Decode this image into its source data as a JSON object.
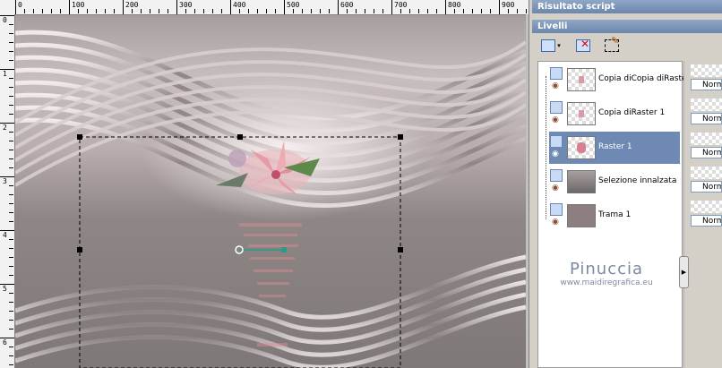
{
  "ruler": {
    "top_labels": [
      "0",
      "100",
      "200",
      "300",
      "400",
      "500",
      "600",
      "700",
      "800",
      "900"
    ],
    "left_labels": [
      "0",
      "1",
      "2",
      "3",
      "4",
      "5",
      "6"
    ]
  },
  "panel": {
    "script_title": "Risultato script",
    "layers_title": "Livelli",
    "layers": [
      {
        "name": "Copia diCopia diRaste",
        "mode": "Norm"
      },
      {
        "name": "Copia diRaster 1",
        "mode": "Norm"
      },
      {
        "name": "Raster 1",
        "mode": "Norm",
        "selected": true
      },
      {
        "name": "Selezione innalzata",
        "mode": "Norm"
      },
      {
        "name": "Trama 1",
        "mode": "Norm"
      }
    ]
  },
  "watermark": {
    "name": "Pinuccia",
    "url": "www.maidiregrafica.eu"
  },
  "colors": {
    "accent": "#6e8ab4",
    "canvas_bg": "#6b7d9d",
    "image_tone": "#a79e9e",
    "flower_pink": "#e0909c"
  },
  "icons": [
    "new-layer-icon",
    "delete-layer-icon",
    "edit-selection-icon",
    "eye-icon",
    "visibility-toggle-icon"
  ]
}
